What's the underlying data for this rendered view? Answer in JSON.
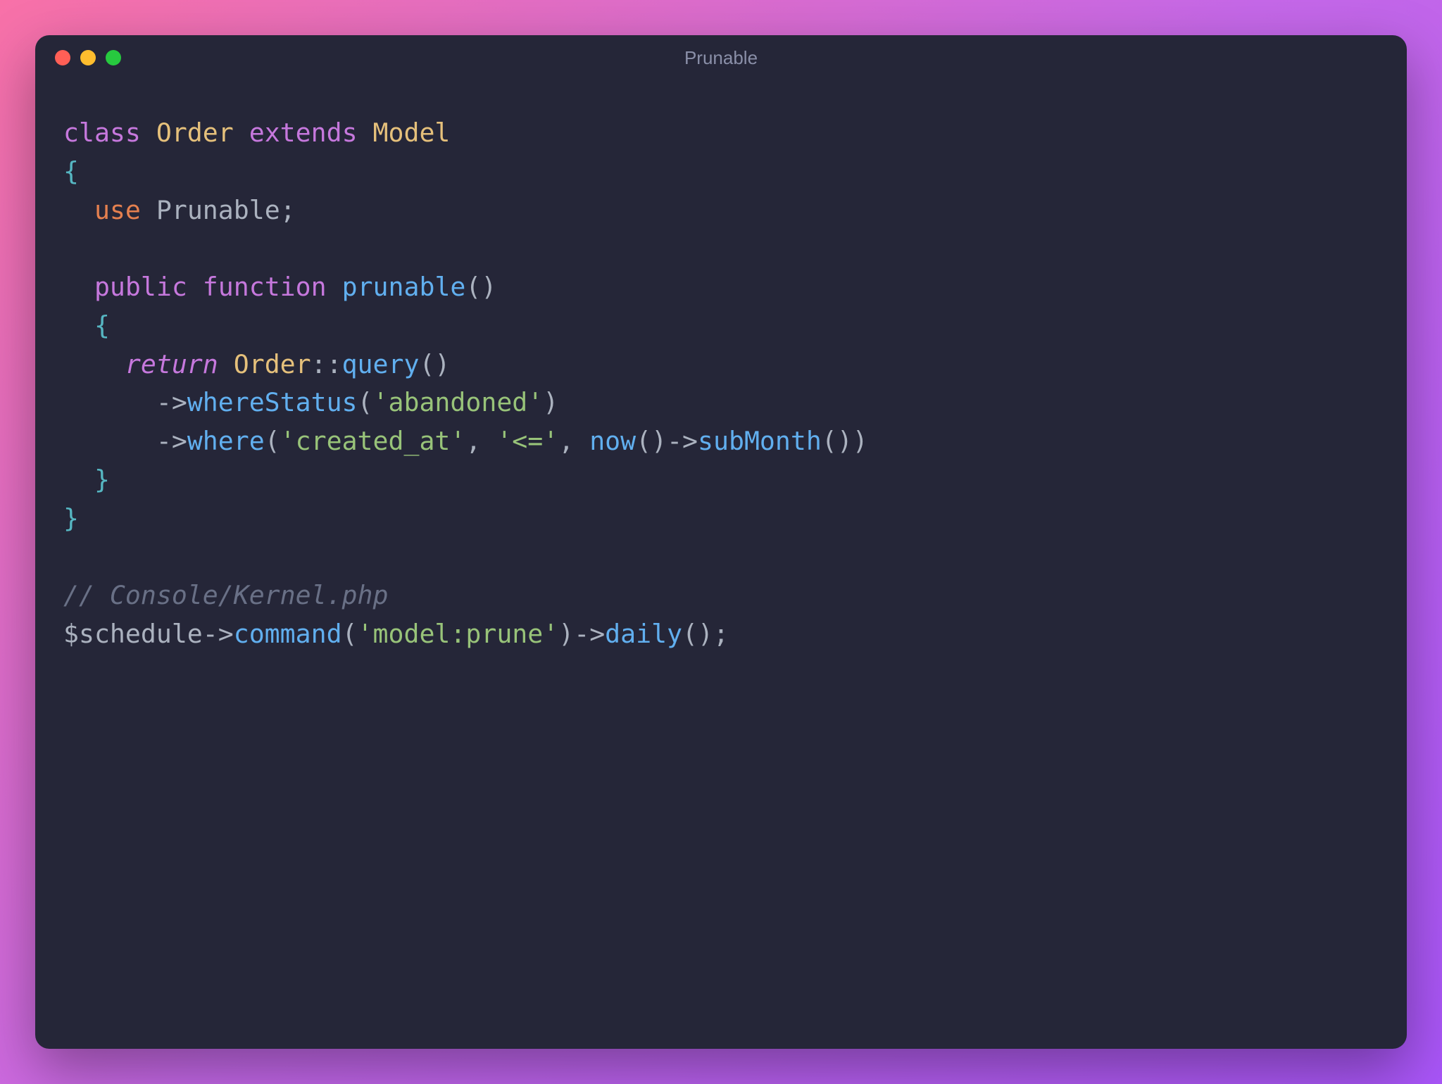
{
  "window": {
    "title": "Prunable"
  },
  "code": {
    "line1": {
      "kw_class": "class",
      "cls_order": "Order",
      "kw_extends": "extends",
      "cls_model": "Model"
    },
    "line2": {
      "brace": "{"
    },
    "line3": {
      "kw_use": "use",
      "ident": "Prunable",
      "semi": ";"
    },
    "line4_blank": "",
    "line5": {
      "kw_public": "public",
      "kw_function": "function",
      "fn_name": "prunable",
      "parens": "()"
    },
    "line6": {
      "brace": "{"
    },
    "line7": {
      "kw_return": "return",
      "cls_order": "Order",
      "dcol": "::",
      "fn_query": "query",
      "parens": "()"
    },
    "line8": {
      "arrow": "->",
      "fn_where_status": "whereStatus",
      "open": "(",
      "str_abandoned": "'abandoned'",
      "close": ")"
    },
    "line9": {
      "arrow": "->",
      "fn_where": "where",
      "open": "(",
      "str_created": "'created_at'",
      "comma1": ", ",
      "str_lte": "'<='",
      "comma2": ", ",
      "fn_now": "now",
      "p1": "()",
      "arrow2": "->",
      "fn_submonth": "subMonth",
      "p2": "()",
      "close": ")"
    },
    "line10": {
      "brace": "}"
    },
    "line11": {
      "brace": "}"
    },
    "line12_blank": "",
    "line13": {
      "comment": "// Console/Kernel.php"
    },
    "line14": {
      "var": "$schedule",
      "arrow": "->",
      "fn_command": "command",
      "open": "(",
      "str_prune": "'model:prune'",
      "close": ")",
      "arrow2": "->",
      "fn_daily": "daily",
      "p": "()",
      "semi": ";"
    }
  }
}
